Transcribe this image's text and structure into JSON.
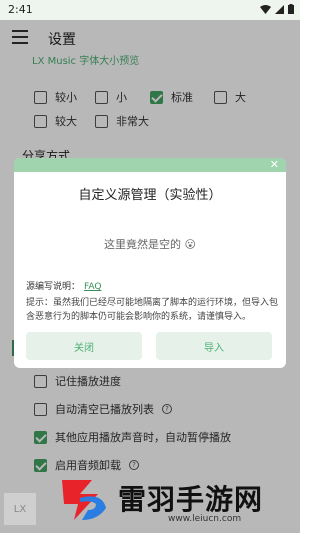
{
  "status": {
    "time": "2:41"
  },
  "appbar": {
    "title": "设置"
  },
  "font_preview": "LX Music 字体大小预览",
  "font_sizes": [
    {
      "label": "较小",
      "checked": false
    },
    {
      "label": "小",
      "checked": false
    },
    {
      "label": "标准",
      "checked": true
    },
    {
      "label": "大",
      "checked": false
    },
    {
      "label": "较大",
      "checked": false
    },
    {
      "label": "非常大",
      "checked": false
    }
  ],
  "share": {
    "title": "分享方式"
  },
  "dialog": {
    "title": "自定义源管理（实验性）",
    "empty": "这里竟然是空的 😮",
    "doc_label": "源编写说明：",
    "doc_link": "FAQ",
    "tip": "提示：虽然我们已经尽可能地隔离了脚本的运行环境，但导入包含恶意行为的脚本仍可能会影响你的系统，请谨慎导入。",
    "cancel": "关闭",
    "import": "导入",
    "close_symbol": "✕"
  },
  "play_settings": [
    {
      "label": "记住播放进度",
      "checked": false
    },
    {
      "label": "自动清空已播放列表",
      "checked": false,
      "help": true
    },
    {
      "label": "其他应用播放声音时，自动暂停播放",
      "checked": true
    },
    {
      "label": "启用音频卸载",
      "checked": true,
      "help": true
    }
  ],
  "player_thumb": "LX",
  "watermark": {
    "name": "雷羽手游网",
    "url": "www.leiucn.com"
  },
  "colors": {
    "accent": "#4caf73",
    "checked": "#43a463",
    "header_bar": "#9fd4ae"
  }
}
